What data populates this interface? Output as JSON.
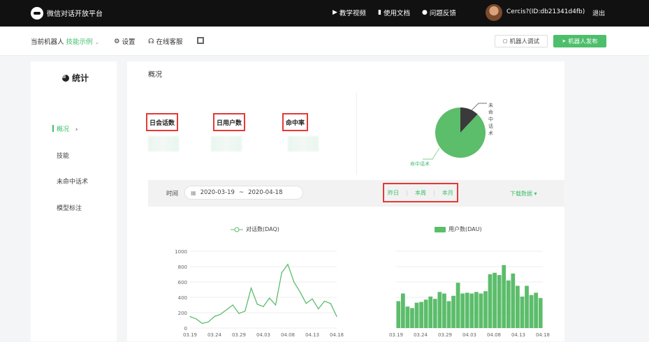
{
  "topbar": {
    "brand": "微信对话开放平台",
    "nav": [
      {
        "label": "教学视频",
        "icon": "play-icon"
      },
      {
        "label": "使用文档",
        "icon": "doc-icon"
      },
      {
        "label": "问题反馈",
        "icon": "user-icon"
      }
    ],
    "user_id": "Cercis?(ID:db21341d4fb)",
    "logout": "退出"
  },
  "subbar": {
    "robot_label": "当前机器人",
    "robot_name": "技能示例",
    "settings": "设置",
    "support": "在线客服",
    "debug_button": "机器人调试",
    "publish_button": "机器人发布"
  },
  "sidebar": {
    "title": "统计",
    "items": [
      {
        "label": "概况",
        "active": true
      },
      {
        "label": "技能",
        "active": false
      },
      {
        "label": "未命中话术",
        "active": false
      },
      {
        "label": "模型标注",
        "active": false
      }
    ]
  },
  "main": {
    "title": "概况",
    "metrics": [
      {
        "label": "日会话数"
      },
      {
        "label": "日用户数"
      },
      {
        "label": "命中率"
      }
    ],
    "pie_labels": {
      "miss": "未命中话术",
      "hit": "命中话术"
    },
    "filter": {
      "time_label": "时间",
      "start_date": "2020-03-19",
      "separator": "~",
      "end_date": "2020-04-18",
      "quick": [
        "昨日",
        "本周",
        "本月"
      ],
      "download": "下载数据"
    }
  },
  "chart_data": [
    {
      "type": "pie",
      "labels": [
        "未命中话术",
        "命中话术"
      ],
      "values": [
        12,
        88
      ],
      "colors": [
        "#3a3a3a",
        "#5cbd6b"
      ]
    },
    {
      "type": "line",
      "legend": [
        "对话数(DAQ)"
      ],
      "y_ticks": [
        "0",
        "200",
        "400",
        "600",
        "800",
        "1000"
      ],
      "x_ticks": [
        "03.19",
        "03.24",
        "03.29",
        "04.03",
        "04.08",
        "04.13",
        "04.18"
      ],
      "ylim": [
        0,
        1000
      ],
      "series": [
        {
          "name": "对话数(DAQ)",
          "color": "#5cbd6b",
          "values": [
            150,
            120,
            60,
            80,
            150,
            180,
            240,
            300,
            190,
            220,
            520,
            310,
            280,
            390,
            300,
            720,
            830,
            600,
            470,
            320,
            380,
            250,
            350,
            320,
            150
          ]
        }
      ]
    },
    {
      "type": "bar",
      "legend": [
        "用户数(DAU)"
      ],
      "x_ticks": [
        "03.19",
        "03.24",
        "03.29",
        "04.03",
        "04.08",
        "04.13",
        "04.18"
      ],
      "ylim": [
        0,
        100
      ],
      "series": [
        {
          "name": "用户数(DAU)",
          "color": "#5cbd6b",
          "values": [
            35,
            45,
            28,
            26,
            33,
            34,
            37,
            41,
            38,
            47,
            45,
            35,
            42,
            59,
            45,
            46,
            45,
            47,
            45,
            48,
            70,
            72,
            69,
            82,
            62,
            71,
            55,
            41,
            55,
            43,
            46,
            39
          ]
        }
      ]
    }
  ]
}
